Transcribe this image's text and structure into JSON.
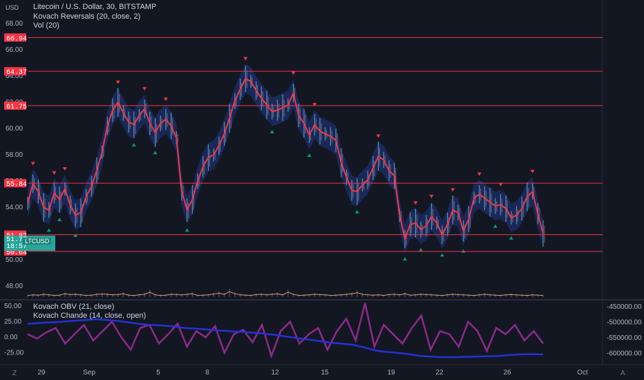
{
  "header": {
    "currency": "USD",
    "title": "Litecoin / U.S. Dollar, 30, BITSTAMP",
    "indicator1": "Kovach Reversals (20, close, 2)",
    "indicator2": "Vol (20)",
    "osc1": "Kovach OBV (21, close)",
    "osc2": "Kovach Chande (14, close, open)"
  },
  "ticker": {
    "symbol": "LTCUSD",
    "price": "51.77",
    "countdown": "18:57"
  },
  "footer": {
    "left_label": "Z",
    "right_label": "A"
  },
  "colors": {
    "background": "#131722",
    "resistance_line": "#f23645",
    "price_line": "#f23645",
    "band": "#1e2f6b",
    "candles": "#5fa8c8",
    "volume": "#d4a26b",
    "buy_marker": "#089981",
    "sell_marker": "#f23645",
    "obv": "#2432d6",
    "chande": "#8e2a8c",
    "ticker_bg": "#26a69a"
  },
  "chart_data": [
    {
      "type": "line",
      "title": "Litecoin / U.S. Dollar, 30, BITSTAMP",
      "ylim": [
        47,
        67.8
      ],
      "yticks": [
        "48.00",
        "50.00",
        "52.00",
        "54.00",
        "56.00",
        "58.00",
        "60.00",
        "62.00",
        "64.00",
        "66.00",
        "68.00"
      ],
      "xticks": [
        "29",
        "Sep",
        "5",
        "8",
        "12",
        "15",
        "19",
        "22",
        "26",
        "Oct"
      ],
      "horizontal_levels": [
        66.94,
        64.37,
        61.75,
        55.84,
        51.92,
        50.64
      ],
      "level_labels": [
        "66.94",
        "64.37",
        "61.75",
        "55.84",
        "51.92",
        "50.64"
      ],
      "series": [
        {
          "name": "Kovach Reversals (20, close, 2)",
          "values": [
            54.3,
            55.8,
            55.2,
            54.0,
            53.8,
            55.1,
            54.6,
            55.4,
            54.2,
            53.4,
            53.6,
            54.8,
            55.6,
            56.8,
            58.2,
            60.2,
            61.4,
            62.0,
            61.2,
            60.5,
            60.3,
            61.0,
            61.5,
            60.4,
            59.7,
            60.4,
            60.7,
            60.2,
            59.3,
            55.2,
            53.8,
            54.6,
            56.0,
            57.1,
            57.8,
            58.0,
            58.7,
            59.6,
            60.8,
            62.1,
            63.0,
            63.8,
            63.6,
            62.9,
            62.3,
            61.8,
            61.3,
            61.4,
            61.6,
            61.8,
            62.7,
            61.0,
            60.4,
            59.5,
            60.3,
            59.8,
            59.6,
            59.4,
            59.1,
            57.4,
            56.3,
            55.3,
            55.2,
            55.7,
            56.1,
            57.0,
            57.9,
            57.6,
            56.8,
            56.4,
            53.4,
            51.6,
            52.7,
            52.8,
            52.3,
            52.6,
            53.3,
            52.8,
            51.9,
            52.7,
            53.8,
            53.6,
            52.2,
            53.1,
            54.7,
            55.0,
            54.7,
            54.4,
            54.1,
            54.2,
            53.9,
            53.2,
            53.4,
            53.9,
            54.8,
            55.2,
            53.5,
            52.0
          ],
          "x_start": "Aug 28",
          "x_end": "Sep 27"
        }
      ]
    },
    {
      "type": "bar",
      "title": "Vol (20)",
      "series": [
        {
          "name": "Vol (20)",
          "values": [
            0.3,
            0.4,
            0.35,
            0.5,
            0.4,
            0.3,
            0.35,
            0.6,
            0.45,
            0.5,
            0.4,
            0.3,
            0.35,
            0.5,
            0.55,
            0.5,
            0.4,
            0.45,
            0.6,
            0.35,
            0.3,
            0.4,
            0.5,
            0.9,
            0.4,
            0.3,
            0.35,
            0.5,
            0.45,
            0.4,
            0.5,
            0.6,
            0.3,
            0.35,
            0.4,
            0.55,
            0.7,
            0.5,
            1.0,
            0.6,
            0.4,
            0.35,
            0.3,
            0.45,
            0.5,
            0.4,
            0.5,
            0.6,
            0.4,
            0.9,
            0.5,
            0.3,
            0.35,
            0.4,
            0.5,
            0.45,
            0.4,
            0.3,
            0.35,
            0.4,
            0.5,
            0.6,
            0.8,
            0.5,
            0.4,
            0.35,
            0.4,
            0.3,
            0.45,
            0.5,
            0.4,
            0.6,
            0.35,
            0.4,
            0.5,
            0.45,
            0.4,
            0.35,
            0.3,
            0.4,
            0.5,
            0.45,
            0.4,
            0.35,
            0.3,
            0.4,
            0.5,
            0.4,
            0.35,
            0.3,
            0.4,
            0.45,
            0.4,
            0.35,
            0.3,
            0.4,
            0.35,
            0.3
          ]
        }
      ]
    },
    {
      "type": "line",
      "title": "Kovach OBV (21, close) / Kovach Chande (14, close, open)",
      "left_yticks": [
        "50.00",
        "25.00",
        "0.00",
        "-25.00"
      ],
      "right_yticks": [
        "-450000.00",
        "-500000.00",
        "-550000.00",
        "-600000.00"
      ],
      "left_ylim": [
        -42,
        58
      ],
      "right_ylim": [
        -632000,
        -432000
      ],
      "series": [
        {
          "name": "Kovach OBV (21, close)",
          "axis": "right",
          "values": [
            -505000,
            -502000,
            -500000,
            -498000,
            -495000,
            -493000,
            -490000,
            -492000,
            -495000,
            -500000,
            -505000,
            -508000,
            -510000,
            -513000,
            -518000,
            -520000,
            -523000,
            -526000,
            -528000,
            -530000,
            -533000,
            -536000,
            -540000,
            -545000,
            -550000,
            -555000,
            -560000,
            -565000,
            -568000,
            -572000,
            -580000,
            -590000,
            -595000,
            -598000,
            -602000,
            -608000,
            -610000,
            -612000,
            -612000,
            -611000,
            -610000,
            -609000,
            -608000,
            -605000,
            -603000,
            -602000,
            -603000
          ]
        },
        {
          "name": "Kovach Chande (14, close, open)",
          "axis": "left",
          "values": [
            5,
            -2,
            8,
            15,
            -10,
            5,
            20,
            -5,
            10,
            25,
            0,
            -20,
            15,
            20,
            -10,
            5,
            22,
            -15,
            10,
            0,
            18,
            -25,
            5,
            12,
            -8,
            20,
            -30,
            10,
            25,
            -10,
            5,
            15,
            -20,
            10,
            30,
            -5,
            55,
            -15,
            20,
            5,
            -10,
            15,
            35,
            -20,
            10,
            5,
            -15,
            25,
            10,
            -22,
            15,
            5,
            20,
            -5,
            10,
            -10
          ]
        }
      ]
    }
  ]
}
